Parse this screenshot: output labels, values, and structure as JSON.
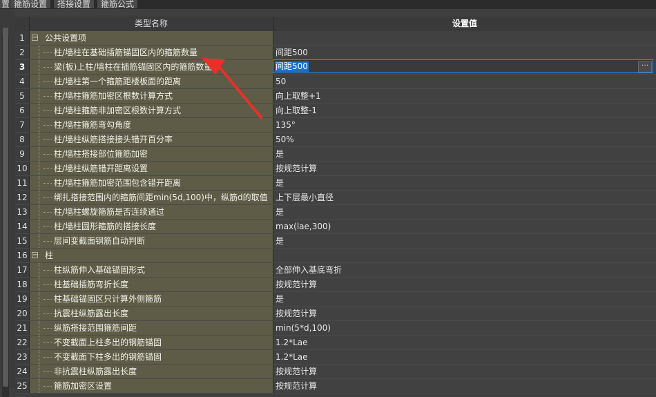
{
  "tabs": [
    {
      "label": "置"
    },
    {
      "label": "箍筋设置"
    },
    {
      "label": "搭接设置"
    },
    {
      "label": "箍筋公式"
    }
  ],
  "header": {
    "name_col": "类型名称",
    "value_col": "设置值"
  },
  "rows": [
    {
      "num": "1",
      "name": "公共设置项",
      "value": "",
      "group": true
    },
    {
      "num": "2",
      "name": "柱/墙柱在基础插筋锚固区内的箍筋数量",
      "value": "间距500"
    },
    {
      "num": "3",
      "name": "梁(板)上柱/墙柱在插筋锚固区内的箍筋数量",
      "value": "间距500",
      "editing": true
    },
    {
      "num": "4",
      "name": "柱/墙柱第一个箍筋距楼板面的距离",
      "value": "50"
    },
    {
      "num": "5",
      "name": "柱/墙柱箍筋加密区根数计算方式",
      "value": "向上取整+1"
    },
    {
      "num": "6",
      "name": "柱/墙柱箍筋非加密区根数计算方式",
      "value": "向上取整-1"
    },
    {
      "num": "7",
      "name": "柱/墙柱箍筋弯勾角度",
      "value": "135°"
    },
    {
      "num": "8",
      "name": "柱/墙柱纵筋搭接接头错开百分率",
      "value": "50%"
    },
    {
      "num": "9",
      "name": "柱/墙柱搭接部位箍筋加密",
      "value": "是"
    },
    {
      "num": "10",
      "name": "柱/墙柱纵筋错开距离设置",
      "value": "按规范计算"
    },
    {
      "num": "11",
      "name": "柱/墙柱箍筋加密范围包含错开距离",
      "value": "是"
    },
    {
      "num": "12",
      "name": "绑扎搭接范围内的箍筋间距min(5d,100)中，纵筋d的取值",
      "value": "上下层最小直径"
    },
    {
      "num": "13",
      "name": "柱/墙柱螺旋箍筋是否连续通过",
      "value": "是"
    },
    {
      "num": "14",
      "name": "柱/墙柱圆形箍筋的搭接长度",
      "value": "max(lae,300)"
    },
    {
      "num": "15",
      "name": "层间变截面钢筋自动判断",
      "value": "是"
    },
    {
      "num": "16",
      "name": "柱",
      "value": "",
      "group": true
    },
    {
      "num": "17",
      "name": "柱纵筋伸入基础锚固形式",
      "value": "全部伸入基底弯折"
    },
    {
      "num": "18",
      "name": "柱基础插筋弯折长度",
      "value": "按规范计算"
    },
    {
      "num": "19",
      "name": "柱基础锚固区只计算外侧箍筋",
      "value": "是"
    },
    {
      "num": "20",
      "name": "抗震柱纵筋露出长度",
      "value": "按规范计算"
    },
    {
      "num": "21",
      "name": "纵筋搭接范围箍筋间距",
      "value": "min(5*d,100)"
    },
    {
      "num": "22",
      "name": "不变截面上柱多出的钢筋锚固",
      "value": "1.2*Lae"
    },
    {
      "num": "23",
      "name": "不变截面下柱多出的钢筋锚固",
      "value": "1.2*Lae"
    },
    {
      "num": "24",
      "name": "非抗震柱纵筋露出长度",
      "value": "按规范计算"
    },
    {
      "num": "25",
      "name": "箍筋加密区设置",
      "value": "按规范计算"
    }
  ],
  "editor": {
    "dots_label": "···"
  },
  "annotation": {
    "color": "#e8302a"
  }
}
